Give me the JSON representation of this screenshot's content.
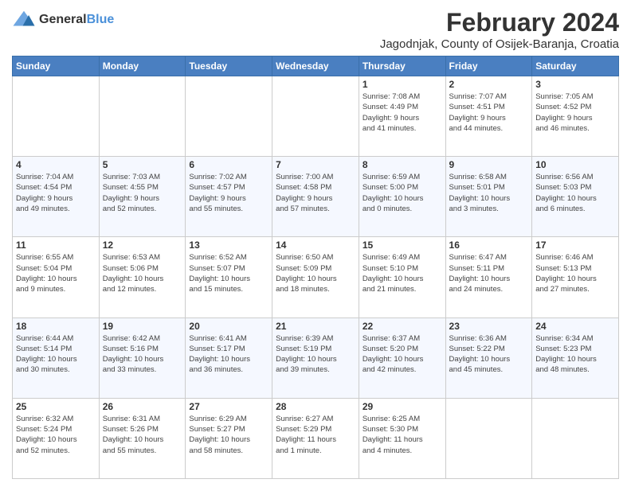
{
  "logo": {
    "general": "General",
    "blue": "Blue"
  },
  "header": {
    "title": "February 2024",
    "subtitle": "Jagodnjak, County of Osijek-Baranja, Croatia"
  },
  "days_header": [
    "Sunday",
    "Monday",
    "Tuesday",
    "Wednesday",
    "Thursday",
    "Friday",
    "Saturday"
  ],
  "weeks": [
    [
      {
        "day": "",
        "info": ""
      },
      {
        "day": "",
        "info": ""
      },
      {
        "day": "",
        "info": ""
      },
      {
        "day": "",
        "info": ""
      },
      {
        "day": "1",
        "info": "Sunrise: 7:08 AM\nSunset: 4:49 PM\nDaylight: 9 hours\nand 41 minutes."
      },
      {
        "day": "2",
        "info": "Sunrise: 7:07 AM\nSunset: 4:51 PM\nDaylight: 9 hours\nand 44 minutes."
      },
      {
        "day": "3",
        "info": "Sunrise: 7:05 AM\nSunset: 4:52 PM\nDaylight: 9 hours\nand 46 minutes."
      }
    ],
    [
      {
        "day": "4",
        "info": "Sunrise: 7:04 AM\nSunset: 4:54 PM\nDaylight: 9 hours\nand 49 minutes."
      },
      {
        "day": "5",
        "info": "Sunrise: 7:03 AM\nSunset: 4:55 PM\nDaylight: 9 hours\nand 52 minutes."
      },
      {
        "day": "6",
        "info": "Sunrise: 7:02 AM\nSunset: 4:57 PM\nDaylight: 9 hours\nand 55 minutes."
      },
      {
        "day": "7",
        "info": "Sunrise: 7:00 AM\nSunset: 4:58 PM\nDaylight: 9 hours\nand 57 minutes."
      },
      {
        "day": "8",
        "info": "Sunrise: 6:59 AM\nSunset: 5:00 PM\nDaylight: 10 hours\nand 0 minutes."
      },
      {
        "day": "9",
        "info": "Sunrise: 6:58 AM\nSunset: 5:01 PM\nDaylight: 10 hours\nand 3 minutes."
      },
      {
        "day": "10",
        "info": "Sunrise: 6:56 AM\nSunset: 5:03 PM\nDaylight: 10 hours\nand 6 minutes."
      }
    ],
    [
      {
        "day": "11",
        "info": "Sunrise: 6:55 AM\nSunset: 5:04 PM\nDaylight: 10 hours\nand 9 minutes."
      },
      {
        "day": "12",
        "info": "Sunrise: 6:53 AM\nSunset: 5:06 PM\nDaylight: 10 hours\nand 12 minutes."
      },
      {
        "day": "13",
        "info": "Sunrise: 6:52 AM\nSunset: 5:07 PM\nDaylight: 10 hours\nand 15 minutes."
      },
      {
        "day": "14",
        "info": "Sunrise: 6:50 AM\nSunset: 5:09 PM\nDaylight: 10 hours\nand 18 minutes."
      },
      {
        "day": "15",
        "info": "Sunrise: 6:49 AM\nSunset: 5:10 PM\nDaylight: 10 hours\nand 21 minutes."
      },
      {
        "day": "16",
        "info": "Sunrise: 6:47 AM\nSunset: 5:11 PM\nDaylight: 10 hours\nand 24 minutes."
      },
      {
        "day": "17",
        "info": "Sunrise: 6:46 AM\nSunset: 5:13 PM\nDaylight: 10 hours\nand 27 minutes."
      }
    ],
    [
      {
        "day": "18",
        "info": "Sunrise: 6:44 AM\nSunset: 5:14 PM\nDaylight: 10 hours\nand 30 minutes."
      },
      {
        "day": "19",
        "info": "Sunrise: 6:42 AM\nSunset: 5:16 PM\nDaylight: 10 hours\nand 33 minutes."
      },
      {
        "day": "20",
        "info": "Sunrise: 6:41 AM\nSunset: 5:17 PM\nDaylight: 10 hours\nand 36 minutes."
      },
      {
        "day": "21",
        "info": "Sunrise: 6:39 AM\nSunset: 5:19 PM\nDaylight: 10 hours\nand 39 minutes."
      },
      {
        "day": "22",
        "info": "Sunrise: 6:37 AM\nSunset: 5:20 PM\nDaylight: 10 hours\nand 42 minutes."
      },
      {
        "day": "23",
        "info": "Sunrise: 6:36 AM\nSunset: 5:22 PM\nDaylight: 10 hours\nand 45 minutes."
      },
      {
        "day": "24",
        "info": "Sunrise: 6:34 AM\nSunset: 5:23 PM\nDaylight: 10 hours\nand 48 minutes."
      }
    ],
    [
      {
        "day": "25",
        "info": "Sunrise: 6:32 AM\nSunset: 5:24 PM\nDaylight: 10 hours\nand 52 minutes."
      },
      {
        "day": "26",
        "info": "Sunrise: 6:31 AM\nSunset: 5:26 PM\nDaylight: 10 hours\nand 55 minutes."
      },
      {
        "day": "27",
        "info": "Sunrise: 6:29 AM\nSunset: 5:27 PM\nDaylight: 10 hours\nand 58 minutes."
      },
      {
        "day": "28",
        "info": "Sunrise: 6:27 AM\nSunset: 5:29 PM\nDaylight: 11 hours\nand 1 minute."
      },
      {
        "day": "29",
        "info": "Sunrise: 6:25 AM\nSunset: 5:30 PM\nDaylight: 11 hours\nand 4 minutes."
      },
      {
        "day": "",
        "info": ""
      },
      {
        "day": "",
        "info": ""
      }
    ]
  ]
}
